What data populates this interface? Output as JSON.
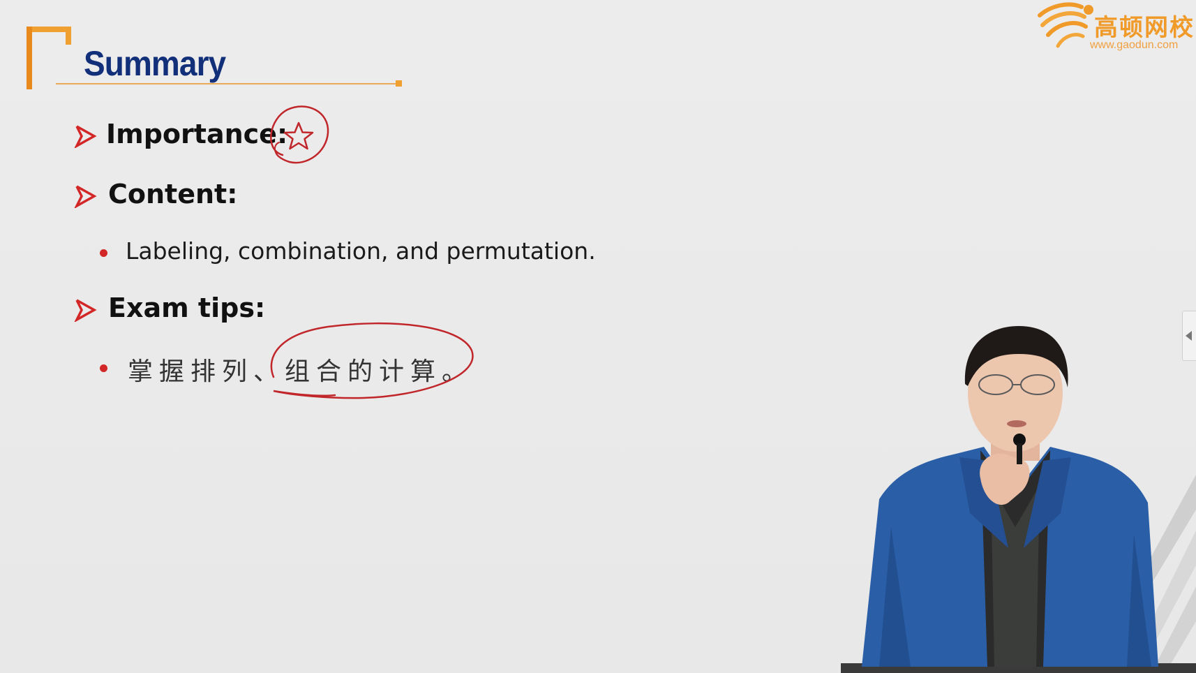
{
  "slide": {
    "title": "Summary",
    "sections": [
      {
        "heading": "Importance:",
        "items": []
      },
      {
        "heading": "Content:",
        "items": [
          "Labeling, combination, and permutation."
        ]
      },
      {
        "heading": "Exam tips:",
        "items": [
          "掌握排列、组合的计算。"
        ]
      }
    ]
  },
  "logo": {
    "name": "高顿网校",
    "url": "www.gaodun.com"
  },
  "icons": {
    "bullet_arrow": "arrow-right-icon",
    "importance_mark": "star-icon",
    "side_toggle": "chevron-left-icon"
  },
  "colors": {
    "title": "#12307a",
    "accent_orange": "#f0a030",
    "bullet_red": "#d32626",
    "annotation_red": "#c0262a",
    "jacket_blue": "#2a5fa8"
  }
}
